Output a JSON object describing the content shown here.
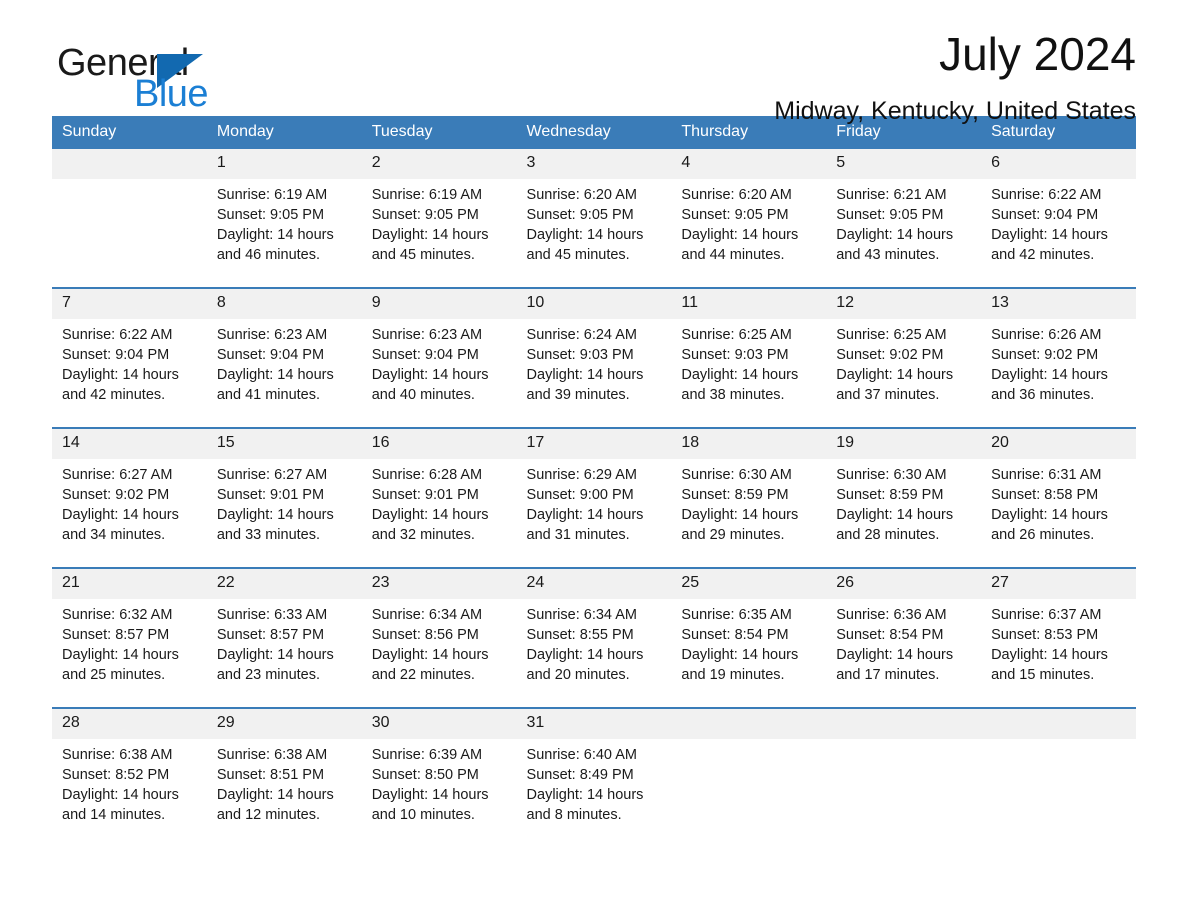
{
  "brand": {
    "word_one": "General",
    "word_two": "Blue",
    "triangle_color": "#1269b0",
    "blue_color": "#1b7fd4"
  },
  "header": {
    "title": "July 2024",
    "location": "Midway, Kentucky, United States"
  },
  "theme": {
    "header_row_bg": "#3a7cb8",
    "daynum_bg": "#f1f1f1",
    "row_border": "#3a7cb8",
    "text": "#1a1a1a"
  },
  "weekday_headers": [
    "Sunday",
    "Monday",
    "Tuesday",
    "Wednesday",
    "Thursday",
    "Friday",
    "Saturday"
  ],
  "weeks": [
    [
      {
        "day": "",
        "blank": true,
        "sunrise": "",
        "sunset": "",
        "daylight_1": "",
        "daylight_2": ""
      },
      {
        "day": "1",
        "sunrise": "Sunrise: 6:19 AM",
        "sunset": "Sunset: 9:05 PM",
        "daylight_1": "Daylight: 14 hours",
        "daylight_2": "and 46 minutes."
      },
      {
        "day": "2",
        "sunrise": "Sunrise: 6:19 AM",
        "sunset": "Sunset: 9:05 PM",
        "daylight_1": "Daylight: 14 hours",
        "daylight_2": "and 45 minutes."
      },
      {
        "day": "3",
        "sunrise": "Sunrise: 6:20 AM",
        "sunset": "Sunset: 9:05 PM",
        "daylight_1": "Daylight: 14 hours",
        "daylight_2": "and 45 minutes."
      },
      {
        "day": "4",
        "sunrise": "Sunrise: 6:20 AM",
        "sunset": "Sunset: 9:05 PM",
        "daylight_1": "Daylight: 14 hours",
        "daylight_2": "and 44 minutes."
      },
      {
        "day": "5",
        "sunrise": "Sunrise: 6:21 AM",
        "sunset": "Sunset: 9:05 PM",
        "daylight_1": "Daylight: 14 hours",
        "daylight_2": "and 43 minutes."
      },
      {
        "day": "6",
        "sunrise": "Sunrise: 6:22 AM",
        "sunset": "Sunset: 9:04 PM",
        "daylight_1": "Daylight: 14 hours",
        "daylight_2": "and 42 minutes."
      }
    ],
    [
      {
        "day": "7",
        "sunrise": "Sunrise: 6:22 AM",
        "sunset": "Sunset: 9:04 PM",
        "daylight_1": "Daylight: 14 hours",
        "daylight_2": "and 42 minutes."
      },
      {
        "day": "8",
        "sunrise": "Sunrise: 6:23 AM",
        "sunset": "Sunset: 9:04 PM",
        "daylight_1": "Daylight: 14 hours",
        "daylight_2": "and 41 minutes."
      },
      {
        "day": "9",
        "sunrise": "Sunrise: 6:23 AM",
        "sunset": "Sunset: 9:04 PM",
        "daylight_1": "Daylight: 14 hours",
        "daylight_2": "and 40 minutes."
      },
      {
        "day": "10",
        "sunrise": "Sunrise: 6:24 AM",
        "sunset": "Sunset: 9:03 PM",
        "daylight_1": "Daylight: 14 hours",
        "daylight_2": "and 39 minutes."
      },
      {
        "day": "11",
        "sunrise": "Sunrise: 6:25 AM",
        "sunset": "Sunset: 9:03 PM",
        "daylight_1": "Daylight: 14 hours",
        "daylight_2": "and 38 minutes."
      },
      {
        "day": "12",
        "sunrise": "Sunrise: 6:25 AM",
        "sunset": "Sunset: 9:02 PM",
        "daylight_1": "Daylight: 14 hours",
        "daylight_2": "and 37 minutes."
      },
      {
        "day": "13",
        "sunrise": "Sunrise: 6:26 AM",
        "sunset": "Sunset: 9:02 PM",
        "daylight_1": "Daylight: 14 hours",
        "daylight_2": "and 36 minutes."
      }
    ],
    [
      {
        "day": "14",
        "sunrise": "Sunrise: 6:27 AM",
        "sunset": "Sunset: 9:02 PM",
        "daylight_1": "Daylight: 14 hours",
        "daylight_2": "and 34 minutes."
      },
      {
        "day": "15",
        "sunrise": "Sunrise: 6:27 AM",
        "sunset": "Sunset: 9:01 PM",
        "daylight_1": "Daylight: 14 hours",
        "daylight_2": "and 33 minutes."
      },
      {
        "day": "16",
        "sunrise": "Sunrise: 6:28 AM",
        "sunset": "Sunset: 9:01 PM",
        "daylight_1": "Daylight: 14 hours",
        "daylight_2": "and 32 minutes."
      },
      {
        "day": "17",
        "sunrise": "Sunrise: 6:29 AM",
        "sunset": "Sunset: 9:00 PM",
        "daylight_1": "Daylight: 14 hours",
        "daylight_2": "and 31 minutes."
      },
      {
        "day": "18",
        "sunrise": "Sunrise: 6:30 AM",
        "sunset": "Sunset: 8:59 PM",
        "daylight_1": "Daylight: 14 hours",
        "daylight_2": "and 29 minutes."
      },
      {
        "day": "19",
        "sunrise": "Sunrise: 6:30 AM",
        "sunset": "Sunset: 8:59 PM",
        "daylight_1": "Daylight: 14 hours",
        "daylight_2": "and 28 minutes."
      },
      {
        "day": "20",
        "sunrise": "Sunrise: 6:31 AM",
        "sunset": "Sunset: 8:58 PM",
        "daylight_1": "Daylight: 14 hours",
        "daylight_2": "and 26 minutes."
      }
    ],
    [
      {
        "day": "21",
        "sunrise": "Sunrise: 6:32 AM",
        "sunset": "Sunset: 8:57 PM",
        "daylight_1": "Daylight: 14 hours",
        "daylight_2": "and 25 minutes."
      },
      {
        "day": "22",
        "sunrise": "Sunrise: 6:33 AM",
        "sunset": "Sunset: 8:57 PM",
        "daylight_1": "Daylight: 14 hours",
        "daylight_2": "and 23 minutes."
      },
      {
        "day": "23",
        "sunrise": "Sunrise: 6:34 AM",
        "sunset": "Sunset: 8:56 PM",
        "daylight_1": "Daylight: 14 hours",
        "daylight_2": "and 22 minutes."
      },
      {
        "day": "24",
        "sunrise": "Sunrise: 6:34 AM",
        "sunset": "Sunset: 8:55 PM",
        "daylight_1": "Daylight: 14 hours",
        "daylight_2": "and 20 minutes."
      },
      {
        "day": "25",
        "sunrise": "Sunrise: 6:35 AM",
        "sunset": "Sunset: 8:54 PM",
        "daylight_1": "Daylight: 14 hours",
        "daylight_2": "and 19 minutes."
      },
      {
        "day": "26",
        "sunrise": "Sunrise: 6:36 AM",
        "sunset": "Sunset: 8:54 PM",
        "daylight_1": "Daylight: 14 hours",
        "daylight_2": "and 17 minutes."
      },
      {
        "day": "27",
        "sunrise": "Sunrise: 6:37 AM",
        "sunset": "Sunset: 8:53 PM",
        "daylight_1": "Daylight: 14 hours",
        "daylight_2": "and 15 minutes."
      }
    ],
    [
      {
        "day": "28",
        "sunrise": "Sunrise: 6:38 AM",
        "sunset": "Sunset: 8:52 PM",
        "daylight_1": "Daylight: 14 hours",
        "daylight_2": "and 14 minutes."
      },
      {
        "day": "29",
        "sunrise": "Sunrise: 6:38 AM",
        "sunset": "Sunset: 8:51 PM",
        "daylight_1": "Daylight: 14 hours",
        "daylight_2": "and 12 minutes."
      },
      {
        "day": "30",
        "sunrise": "Sunrise: 6:39 AM",
        "sunset": "Sunset: 8:50 PM",
        "daylight_1": "Daylight: 14 hours",
        "daylight_2": "and 10 minutes."
      },
      {
        "day": "31",
        "sunrise": "Sunrise: 6:40 AM",
        "sunset": "Sunset: 8:49 PM",
        "daylight_1": "Daylight: 14 hours",
        "daylight_2": "and 8 minutes."
      },
      {
        "day": "",
        "blank": true,
        "sunrise": "",
        "sunset": "",
        "daylight_1": "",
        "daylight_2": ""
      },
      {
        "day": "",
        "blank": true,
        "sunrise": "",
        "sunset": "",
        "daylight_1": "",
        "daylight_2": ""
      },
      {
        "day": "",
        "blank": true,
        "sunrise": "",
        "sunset": "",
        "daylight_1": "",
        "daylight_2": ""
      }
    ]
  ]
}
